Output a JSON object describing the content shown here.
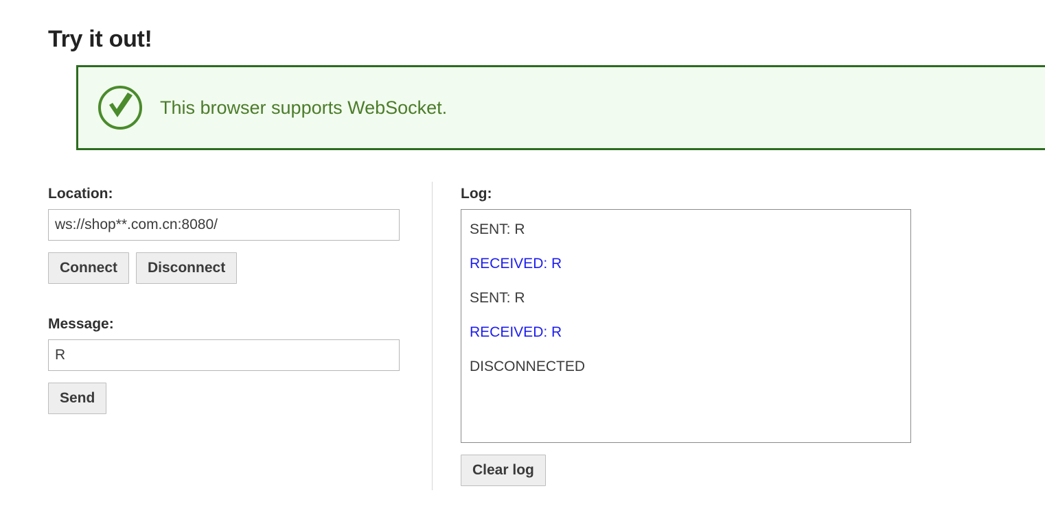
{
  "page": {
    "title": "Try it out!"
  },
  "banner": {
    "icon": "circle-check-icon",
    "text": "This browser supports WebSocket.",
    "border_color": "#2c6b1f",
    "background_color": "#f2fbef",
    "text_color": "#4a7c2a"
  },
  "location": {
    "label": "Location:",
    "value": "ws://shop**.com.cn:8080/",
    "placeholder": "",
    "connect_label": "Connect",
    "disconnect_label": "Disconnect"
  },
  "message": {
    "label": "Message:",
    "value": "R",
    "placeholder": "",
    "send_label": "Send"
  },
  "log": {
    "label": "Log:",
    "clear_label": "Clear log",
    "sent_color": "#3b3b3b",
    "received_color": "#1c1cf0",
    "entries": [
      {
        "kind": "sent",
        "text": "SENT: R"
      },
      {
        "kind": "received",
        "text": "RECEIVED: R"
      },
      {
        "kind": "sent",
        "text": "SENT: R"
      },
      {
        "kind": "received",
        "text": "RECEIVED: R"
      },
      {
        "kind": "status",
        "text": "DISCONNECTED"
      }
    ]
  }
}
